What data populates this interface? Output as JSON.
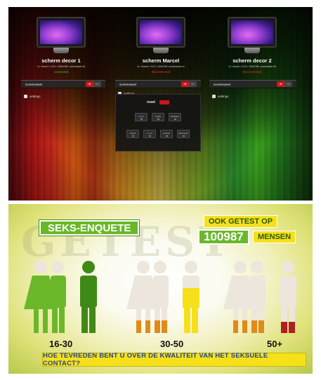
{
  "top": {
    "screens": [
      {
        "name": "scherm decor 1",
        "info": "v1 • decor1 • 0:0:0 • 1024x768 • screensaver:off",
        "status": "connected",
        "status_type": "connected"
      },
      {
        "name": "scherm Marcel",
        "info": "v1 • marcel • 0:0:0 • 1024x768 • screensaver:on",
        "status": "disconnected",
        "status_type": "disconnected"
      },
      {
        "name": "scherm decor 2",
        "info": "v1 • decor2 • 0:0:0 • 1024x768 • screensaver:off",
        "status": "disconnected",
        "status_type": "disconnected"
      }
    ],
    "screensaver_label": "screensaver",
    "toggle_off": "off",
    "toggle_on": "on",
    "settings_label": "settings",
    "reset_label": "reset",
    "panel_row1": [
      "logout",
      "restart",
      "shutdown"
    ],
    "panel_row2": [
      "refresh",
      "update",
      "connect",
      "disconnect"
    ]
  },
  "bottom": {
    "ghost_text": "GETEST",
    "title": "SEKS-ENQUETE",
    "tested_label": "OOK GETEST OP",
    "tested_number": "100987",
    "tested_unit": "MENSEN",
    "age_groups": [
      "16-30",
      "30-50",
      "50+"
    ],
    "question": "HOE TEVREDEN BENT U OVER DE KWALITEIT VAN HET SEKSUELE CONTACT?"
  },
  "colors": {
    "green": "#6ab82a",
    "dark_green": "#3f8a16",
    "orange": "#e08a1a",
    "yellow": "#f5e01a",
    "red": "#b02020",
    "beige": "#ece6dc"
  }
}
